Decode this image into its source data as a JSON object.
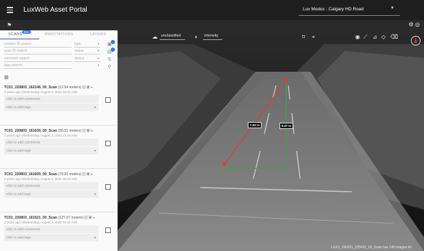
{
  "app": {
    "title": "LuxWeb Asset Portal"
  },
  "dataset": {
    "label": "Lux Modus : Calgary HD Road"
  },
  "tabs": [
    {
      "label": "SCANS",
      "badge": "99+"
    },
    {
      "label": "ANNOTATIONS"
    },
    {
      "label": "LAYERS"
    }
  ],
  "filters": {
    "session_placeholder": "session ID search",
    "scan_placeholder": "scan ID search",
    "comment_placeholder": "comment search",
    "tags_placeholder": "tags search",
    "type_label": "type",
    "status_label": "status",
    "device_label": "device"
  },
  "scans": [
    {
      "id": "TC01_220803_162146_00_Scan",
      "meters": "(12.54 meters)",
      "date": "2 years ago (Wednesday, August 3, 2022 10:21 AM)",
      "comment_placeholder": "click to add comments",
      "tags_placeholder": "click to add tags"
    },
    {
      "id": "TC01_220803_161635_00_Scan",
      "meters": "(90.51 meters)",
      "date": "2 years ago (Wednesday, August 3, 2022 10:16 AM)",
      "comment_placeholder": "click to add comments",
      "tags_placeholder": "click to add tags"
    },
    {
      "id": "TC01_220803_161605_00_Scan",
      "meters": "(79.81 meters)",
      "date": "2 years ago (Wednesday, August 3, 2022 10:16 AM)",
      "comment_placeholder": "click to add comments",
      "tags_placeholder": "click to add tags"
    },
    {
      "id": "TC01_220803_161521_00_Scan",
      "meters": "(127.07 meters)",
      "date": "2 years ago (Wednesday, August 3, 2022 10:15 AM)",
      "comment_placeholder": "click to add comments",
      "tags_placeholder": "click to add tags"
    }
  ],
  "viewer": {
    "class_filter": "unclassified",
    "color_mode": "intensity",
    "measure_diag": "7.93 m",
    "measure_vert": "9.47 m",
    "status": "LUX1_240201_225411_00_Scan has 140 images kn"
  },
  "colors": {
    "topbar": "#1e1e1e",
    "accent": "#2979ff",
    "measure_red": "#e53935",
    "measure_green": "#43a047"
  },
  "icons": [
    "menu-icon",
    "flag-icon",
    "settings-icon",
    "calendar-icon",
    "info-icon",
    "image-icon",
    "status-dot-icon",
    "compass-icon",
    "camera-icon"
  ]
}
